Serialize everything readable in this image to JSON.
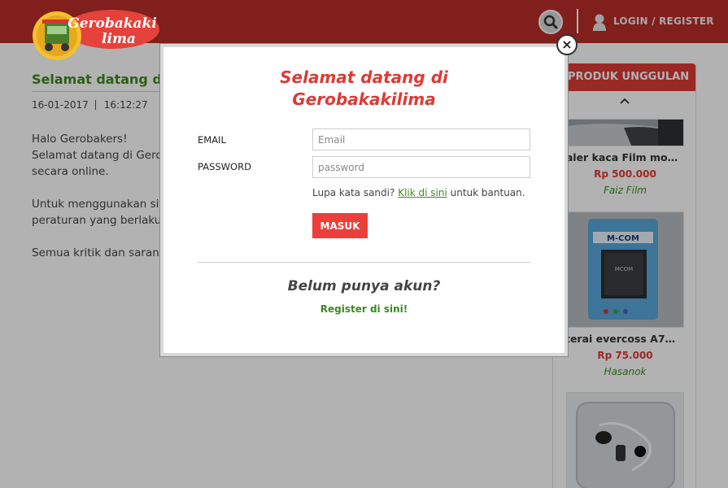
{
  "header": {
    "logo_text": "Gerobakaki lima",
    "login_label": "LOGIN / REGISTER",
    "brand_color": "#b92d2a"
  },
  "post": {
    "title": "Selamat datang di g",
    "date": "16-01-2017",
    "time": "16:12:27",
    "paragraphs": [
      "Halo Gerobakers!",
      "Selamat datang di Gerobal",
      "secara online.",
      "Untuk menggunakan situs",
      "peraturan yang berlaku.",
      "Semua kritik dan saran da"
    ]
  },
  "sidebar": {
    "header": "PRODUK UNGGULAN",
    "products": [
      {
        "name": "Dealer kaca Film mobil...",
        "price": "Rp 500.000",
        "seller": "Faiz Film"
      },
      {
        "name": "Baterai evercoss A74a ...",
        "price": "Rp 75.000",
        "seller": "Hasanok"
      },
      {
        "name": "",
        "price": "",
        "seller": ""
      }
    ],
    "battery_label": "M-COM"
  },
  "modal": {
    "title_line1": "Selamat datang di",
    "title_line2": "Gerobakakilima",
    "email_label": "EMAIL",
    "email_placeholder": "Email",
    "password_label": "PASSWORD",
    "password_placeholder": "password",
    "forgot_text": "Lupa kata sandi?",
    "forgot_link": "Klik di sini",
    "forgot_suffix": "untuk bantuan.",
    "submit_label": "MASUK",
    "no_account": "Belum punya akun?",
    "register_link": "Register di sini!",
    "close_glyph": "×"
  },
  "icons": {
    "search": "search-icon",
    "user": "user-icon",
    "close": "close-icon",
    "chevron_up": "chevron-up-icon"
  },
  "colors": {
    "accent_red": "#dd3a35",
    "accent_green": "#3c8a1e"
  }
}
